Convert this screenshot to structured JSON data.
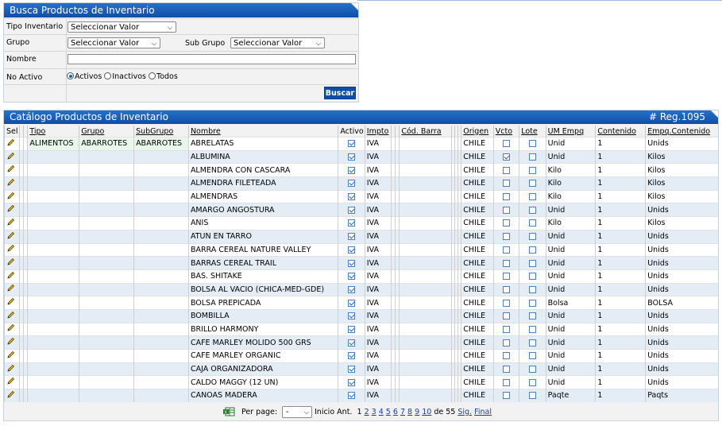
{
  "search": {
    "title": "Busca Productos de Inventario",
    "tipo_label": "Tipo Inventario",
    "tipo_value": "Seleccionar Valor",
    "grupo_label": "Grupo",
    "grupo_value": "Seleccionar Valor",
    "subgrupo_label": "Sub Grupo",
    "subgrupo_value": "Seleccionar Valor",
    "nombre_label": "Nombre",
    "nombre_value": "",
    "noactivo_label": "No Activo",
    "radio_activos": "Activos",
    "radio_inactivos": "Inactivos",
    "radio_todos": "Todos",
    "buscar": "Buscar"
  },
  "catalog": {
    "title": "Catálogo Productos de Inventario",
    "reg": "# Reg.1095",
    "columns": [
      "Sel",
      "Tipo",
      "Grupo",
      "SubGrupo",
      "Nombre",
      "Activo",
      "Impto",
      "Cód. Barra",
      "Origen",
      "Vcto",
      "Lote",
      "UM Empq",
      "Contenido",
      "Empq.Contenido"
    ],
    "rows": [
      {
        "tipo": "ALIMENTOS",
        "grupo": "ABARROTES",
        "subgrupo": "ABARROTES",
        "nombre": "ABRELATAS",
        "activo": true,
        "impto": "IVA",
        "origen": "CHILE",
        "vcto": false,
        "lote": false,
        "um": "Unid",
        "contenido": "1",
        "empq": "Unids"
      },
      {
        "tipo": "",
        "grupo": "",
        "subgrupo": "",
        "nombre": "ALBUMINA",
        "activo": true,
        "impto": "IVA",
        "origen": "CHILE",
        "vcto": true,
        "lote": false,
        "um": "Unid",
        "contenido": "1",
        "empq": "Kilos"
      },
      {
        "tipo": "",
        "grupo": "",
        "subgrupo": "",
        "nombre": "ALMENDRA CON CASCARA",
        "activo": true,
        "impto": "IVA",
        "origen": "CHILE",
        "vcto": false,
        "lote": false,
        "um": "Kilo",
        "contenido": "1",
        "empq": "Kilos"
      },
      {
        "tipo": "",
        "grupo": "",
        "subgrupo": "",
        "nombre": "ALMENDRA FILETEADA",
        "activo": true,
        "impto": "IVA",
        "origen": "CHILE",
        "vcto": false,
        "lote": false,
        "um": "Kilo",
        "contenido": "1",
        "empq": "Kilos"
      },
      {
        "tipo": "",
        "grupo": "",
        "subgrupo": "",
        "nombre": "ALMENDRAS",
        "activo": true,
        "impto": "IVA",
        "origen": "CHILE",
        "vcto": false,
        "lote": false,
        "um": "Kilo",
        "contenido": "1",
        "empq": "Kilos"
      },
      {
        "tipo": "",
        "grupo": "",
        "subgrupo": "",
        "nombre": "AMARGO ANGOSTURA",
        "activo": true,
        "impto": "IVA",
        "origen": "CHILE",
        "vcto": false,
        "lote": false,
        "um": "Unid",
        "contenido": "1",
        "empq": "Unids"
      },
      {
        "tipo": "",
        "grupo": "",
        "subgrupo": "",
        "nombre": "ANIS",
        "activo": true,
        "impto": "IVA",
        "origen": "CHILE",
        "vcto": false,
        "lote": false,
        "um": "Kilo",
        "contenido": "1",
        "empq": "Kilos"
      },
      {
        "tipo": "",
        "grupo": "",
        "subgrupo": "",
        "nombre": "ATUN EN TARRO",
        "activo": true,
        "impto": "IVA",
        "origen": "CHILE",
        "vcto": false,
        "lote": false,
        "um": "Unid",
        "contenido": "1",
        "empq": "Unids"
      },
      {
        "tipo": "",
        "grupo": "",
        "subgrupo": "",
        "nombre": "BARRA CEREAL NATURE VALLEY",
        "activo": true,
        "impto": "IVA",
        "origen": "CHILE",
        "vcto": false,
        "lote": false,
        "um": "Unid",
        "contenido": "1",
        "empq": "Unids"
      },
      {
        "tipo": "",
        "grupo": "",
        "subgrupo": "",
        "nombre": "BARRAS CEREAL TRAIL",
        "activo": true,
        "impto": "IVA",
        "origen": "CHILE",
        "vcto": false,
        "lote": false,
        "um": "Unid",
        "contenido": "1",
        "empq": "Unids"
      },
      {
        "tipo": "",
        "grupo": "",
        "subgrupo": "",
        "nombre": "BAS. SHITAKE",
        "activo": true,
        "impto": "IVA",
        "origen": "CHILE",
        "vcto": false,
        "lote": false,
        "um": "Unid",
        "contenido": "1",
        "empq": "Unids"
      },
      {
        "tipo": "",
        "grupo": "",
        "subgrupo": "",
        "nombre": "BOLSA AL VACIO (CHICA-MED-GDE)",
        "activo": true,
        "impto": "IVA",
        "origen": "CHILE",
        "vcto": false,
        "lote": false,
        "um": "Unid",
        "contenido": "1",
        "empq": "Unids"
      },
      {
        "tipo": "",
        "grupo": "",
        "subgrupo": "",
        "nombre": "BOLSA PREPICADA",
        "activo": true,
        "impto": "IVA",
        "origen": "CHILE",
        "vcto": false,
        "lote": false,
        "um": "Bolsa",
        "contenido": "1",
        "empq": "BOLSA"
      },
      {
        "tipo": "",
        "grupo": "",
        "subgrupo": "",
        "nombre": "BOMBILLA",
        "activo": true,
        "impto": "IVA",
        "origen": "CHILE",
        "vcto": false,
        "lote": false,
        "um": "Unid",
        "contenido": "1",
        "empq": "Unids"
      },
      {
        "tipo": "",
        "grupo": "",
        "subgrupo": "",
        "nombre": "BRILLO HARMONY",
        "activo": true,
        "impto": "IVA",
        "origen": "CHILE",
        "vcto": false,
        "lote": false,
        "um": "Unid",
        "contenido": "1",
        "empq": "Unids"
      },
      {
        "tipo": "",
        "grupo": "",
        "subgrupo": "",
        "nombre": "CAFE MARLEY MOLIDO 500 GRS",
        "activo": true,
        "impto": "IVA",
        "origen": "CHILE",
        "vcto": false,
        "lote": false,
        "um": "Unid",
        "contenido": "1",
        "empq": "Unids"
      },
      {
        "tipo": "",
        "grupo": "",
        "subgrupo": "",
        "nombre": "CAFE MARLEY ORGANIC",
        "activo": true,
        "impto": "IVA",
        "origen": "CHILE",
        "vcto": false,
        "lote": false,
        "um": "Unid",
        "contenido": "1",
        "empq": "Unids"
      },
      {
        "tipo": "",
        "grupo": "",
        "subgrupo": "",
        "nombre": "CAJA ORGANIZADORA",
        "activo": true,
        "impto": "IVA",
        "origen": "CHILE",
        "vcto": false,
        "lote": false,
        "um": "Unid",
        "contenido": "1",
        "empq": "Unids"
      },
      {
        "tipo": "",
        "grupo": "",
        "subgrupo": "",
        "nombre": "CALDO MAGGY (12 UN)",
        "activo": true,
        "impto": "IVA",
        "origen": "CHILE",
        "vcto": false,
        "lote": false,
        "um": "Unid",
        "contenido": "1",
        "empq": "Unids"
      },
      {
        "tipo": "",
        "grupo": "",
        "subgrupo": "",
        "nombre": "CANOAS MADERA",
        "activo": true,
        "impto": "IVA",
        "origen": "CHILE",
        "vcto": false,
        "lote": false,
        "um": "Paqte",
        "contenido": "1",
        "empq": "Paqts"
      }
    ]
  },
  "pager": {
    "per_page": "Per page:",
    "per_page_value": "-",
    "inicio": "Inicio",
    "ant": "Ant.",
    "current": "1",
    "pages": [
      "2",
      "3",
      "4",
      "5",
      "6",
      "7",
      "8",
      "9",
      "10"
    ],
    "de": "de 55",
    "sig": "Sig.",
    "final": "Final"
  },
  "colors": {
    "header": "#0d4fa8",
    "row_alt": "#e4ecf5",
    "group_cell": "#e8f6ec",
    "link": "#1a3fa8"
  }
}
